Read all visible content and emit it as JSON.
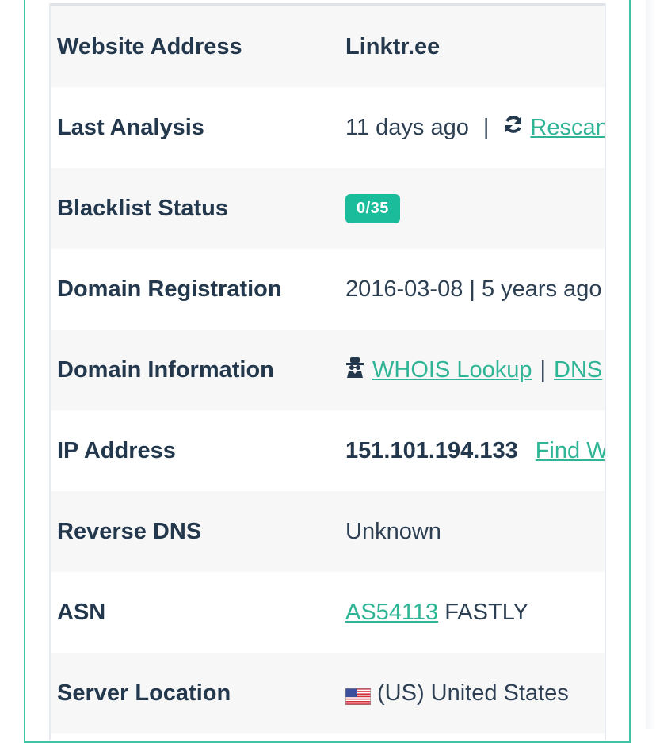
{
  "rows": {
    "website": {
      "label": "Website Address",
      "value": "Linktr.ee"
    },
    "analysis": {
      "label": "Last Analysis",
      "value": "11 days ago",
      "separator": "|",
      "rescan_label": "Rescan"
    },
    "blacklist": {
      "label": "Blacklist Status",
      "badge": "0/35"
    },
    "registration": {
      "label": "Domain Registration",
      "value": "2016-03-08 | 5 years ago"
    },
    "domain_info": {
      "label": "Domain Information",
      "whois_label": "WHOIS Lookup",
      "separator": "|",
      "dns_label": "DNS"
    },
    "ip": {
      "label": "IP Address",
      "value": "151.101.194.133",
      "find_label": "Find W"
    },
    "reverse_dns": {
      "label": "Reverse DNS",
      "value": "Unknown"
    },
    "asn": {
      "label": "ASN",
      "link": "AS54113",
      "value": "FASTLY"
    },
    "location": {
      "label": "Server Location",
      "value": "(US) United States"
    }
  },
  "colors": {
    "accent": "#1abc9c",
    "link": "#2fb595",
    "border": "#3fc3a4"
  },
  "icons": {
    "rescan": "refresh-icon",
    "whois": "spy-icon",
    "flag": "us-flag-icon"
  }
}
